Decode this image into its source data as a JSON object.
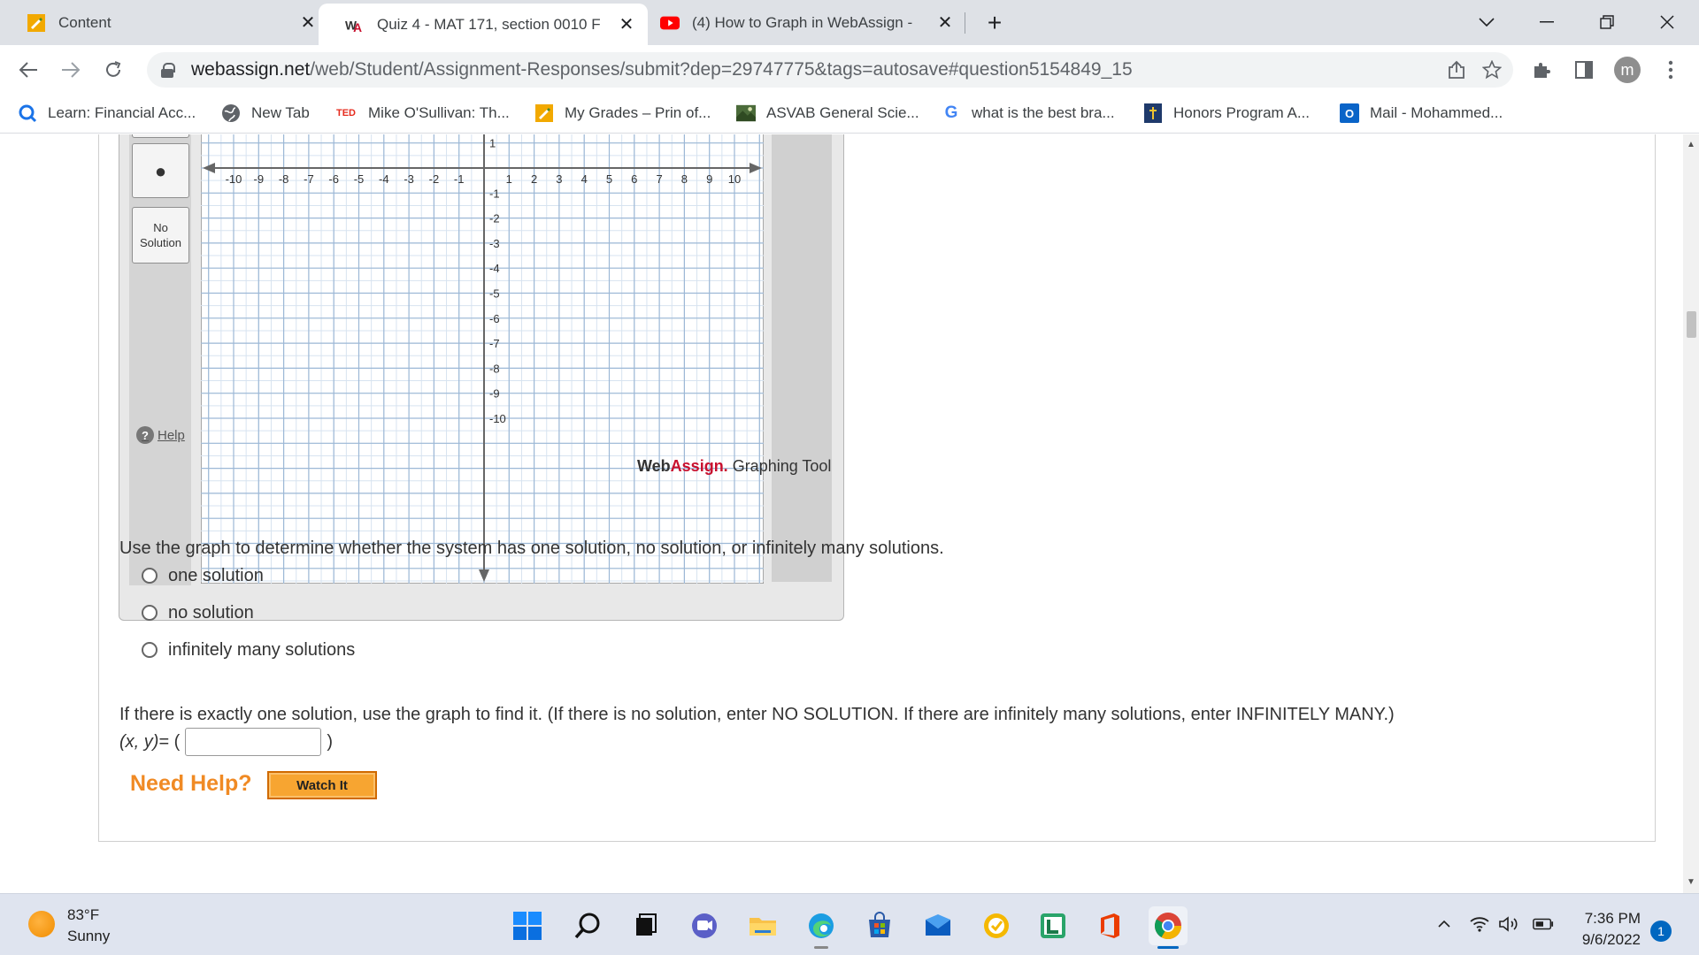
{
  "browser": {
    "tabs": [
      {
        "title": "Content",
        "icon": "pencil-favicon",
        "active": false
      },
      {
        "title": "Quiz 4 - MAT 171, section 0010 F",
        "icon": "webassign-favicon",
        "active": true
      },
      {
        "title": "(4) How to Graph in WebAssign -",
        "icon": "youtube-favicon",
        "active": false
      }
    ],
    "new_tab": "+",
    "close_glyph": "✕",
    "url": {
      "host": "webassign.net",
      "path": "/web/Student/Assignment-Responses/submit?dep=29747775&tags=autosave#question5154849_15"
    },
    "profile_initial": "m",
    "bookmarks": [
      {
        "label": "Learn: Financial Acc...",
        "icon": "search-q-icon"
      },
      {
        "label": "New Tab",
        "icon": "globe-icon"
      },
      {
        "label": "Mike O'Sullivan: Th...",
        "icon": "ted-icon",
        "icon_text": "TED"
      },
      {
        "label": "My Grades – Prin of...",
        "icon": "pencil-favicon"
      },
      {
        "label": "ASVAB General Scie...",
        "icon": "image-thumb-icon"
      },
      {
        "label": "what is the best bra...",
        "icon": "google-icon",
        "icon_text": "G"
      },
      {
        "label": "Honors Program A...",
        "icon": "shield-crest-icon"
      },
      {
        "label": "Mail - Mohammed...",
        "icon": "outlook-icon",
        "icon_text": "O"
      }
    ]
  },
  "graph_tool": {
    "buttons": {
      "point_glyph": "●",
      "no_solution": "No Solution"
    },
    "help_label": "Help",
    "help_glyph": "?",
    "logo": {
      "web": "Web",
      "assign": "Assign.",
      "graphing": " Graphing Tool"
    },
    "x_ticks": [
      "-10",
      "-9",
      "-8",
      "-7",
      "-6",
      "-5",
      "-4",
      "-3",
      "-2",
      "-1",
      "1",
      "2",
      "3",
      "4",
      "5",
      "6",
      "7",
      "8",
      "9",
      "10"
    ],
    "y_ticks": [
      "1",
      "-1",
      "-2",
      "-3",
      "-4",
      "-5",
      "-6",
      "-7",
      "-8",
      "-9",
      "-10"
    ]
  },
  "question": {
    "prompt": "Use the graph to determine whether the system has one solution, no solution, or infinitely many solutions.",
    "options": [
      "one solution",
      "no solution",
      "infinitely many solutions"
    ],
    "instructions": "If there is exactly one solution, use the graph to find it. (If there is no solution, enter NO SOLUTION. If there are infinitely many solutions, enter INFINITELY MANY.)",
    "xy_label": "(x, y)",
    "equals_open": " = (",
    "close_paren": ")",
    "answer_value": "",
    "need_help": "Need Help?",
    "watch_it": "Watch It"
  },
  "taskbar": {
    "weather": {
      "temp": "83°F",
      "condition": "Sunny"
    },
    "clock": {
      "time": "7:36 PM",
      "date": "9/6/2022"
    },
    "notifications": "1"
  },
  "colors": {
    "accent_blue": "#0067c0",
    "webassign_red": "#c8102e",
    "need_help_orange": "#f08a24",
    "watch_button": "#f7a531",
    "grid_line": "#9db8d6"
  }
}
